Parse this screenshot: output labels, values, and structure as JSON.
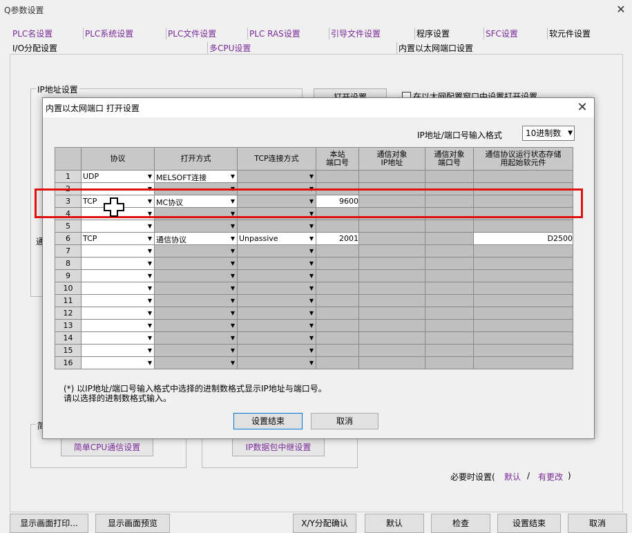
{
  "window": {
    "title": "Q参数设置",
    "close_glyph": "✕"
  },
  "tabs_row1": [
    "PLC名设置",
    "PLC系统设置",
    "PLC文件设置",
    "PLC RAS设置",
    "引导文件设置",
    "程序设置",
    "SFC设置",
    "软元件设置"
  ],
  "tabs_row2": [
    "I/O分配设置",
    "多CPU设置",
    "内置以太网端口设置"
  ],
  "panel": {
    "ip_group_label": "IP地址设置",
    "open_settings_button": "打开设置",
    "online_checkbox_label": "在以太网配置窗口中设置打开设置",
    "comm_group_label": "通",
    "simple_group_label": "简",
    "simple_cpu_button": "简单CPU通信设置",
    "ip_relay_button": "IP数据包中继设置",
    "when_needed_label": "必要时设置(",
    "default_link": "默认",
    "slash": "/",
    "changed_link": "有更改",
    "close_paren": ")"
  },
  "bottom_bar": {
    "print": "显示画面打印...",
    "preview": "显示画面预览",
    "xy_check": "X/Y分配确认",
    "default": "默认",
    "check": "检查",
    "end": "设置结束",
    "cancel": "取消"
  },
  "dialog": {
    "title": "内置以太网端口 打开设置",
    "close_glyph": "✕",
    "format_label": "IP地址/端口号输入格式",
    "format_value": "10进制数",
    "headers": {
      "protocol": "协议",
      "open_method": "打开方式",
      "tcp_method": "TCP连接方式",
      "local_port_1": "本站",
      "local_port_2": "端口号",
      "target_ip_1": "通信对象",
      "target_ip_2": "IP地址",
      "target_port_1": "通信对象",
      "target_port_2": "端口号",
      "status_dev_1": "通信协议运行状态存储",
      "status_dev_2": "用起始软元件"
    },
    "rows": [
      {
        "no": "1",
        "protocol": "UDP",
        "open": "MELSOFT连接",
        "tcp": "",
        "port": "",
        "dev": ""
      },
      {
        "no": "2",
        "protocol": "",
        "open": "",
        "tcp": "",
        "port": "",
        "dev": ""
      },
      {
        "no": "3",
        "protocol": "TCP",
        "open": "MC协议",
        "tcp": "",
        "port": "9600",
        "dev": ""
      },
      {
        "no": "4",
        "protocol": "",
        "open": "",
        "tcp": "",
        "port": "",
        "dev": ""
      },
      {
        "no": "5",
        "protocol": "",
        "open": "",
        "tcp": "",
        "port": "",
        "dev": ""
      },
      {
        "no": "6",
        "protocol": "TCP",
        "open": "通信协议",
        "tcp": "Unpassive",
        "port": "2001",
        "dev": "D2500"
      },
      {
        "no": "7",
        "protocol": "",
        "open": "",
        "tcp": "",
        "port": "",
        "dev": ""
      },
      {
        "no": "8",
        "protocol": "",
        "open": "",
        "tcp": "",
        "port": "",
        "dev": ""
      },
      {
        "no": "9",
        "protocol": "",
        "open": "",
        "tcp": "",
        "port": "",
        "dev": ""
      },
      {
        "no": "10",
        "protocol": "",
        "open": "",
        "tcp": "",
        "port": "",
        "dev": ""
      },
      {
        "no": "11",
        "protocol": "",
        "open": "",
        "tcp": "",
        "port": "",
        "dev": ""
      },
      {
        "no": "12",
        "protocol": "",
        "open": "",
        "tcp": "",
        "port": "",
        "dev": ""
      },
      {
        "no": "13",
        "protocol": "",
        "open": "",
        "tcp": "",
        "port": "",
        "dev": ""
      },
      {
        "no": "14",
        "protocol": "",
        "open": "",
        "tcp": "",
        "port": "",
        "dev": ""
      },
      {
        "no": "15",
        "protocol": "",
        "open": "",
        "tcp": "",
        "port": "",
        "dev": ""
      },
      {
        "no": "16",
        "protocol": "",
        "open": "",
        "tcp": "",
        "port": "",
        "dev": ""
      }
    ],
    "note_line1": "(*) 以IP地址/端口号输入格式中选择的进制数格式显示IP地址与端口号。",
    "note_line2": "请以选择的进制数格式输入。",
    "ok_button": "设置结束",
    "cancel_button": "取消"
  },
  "colors": {
    "highlight": "#e01010",
    "link_purple": "#7a2a9a"
  }
}
